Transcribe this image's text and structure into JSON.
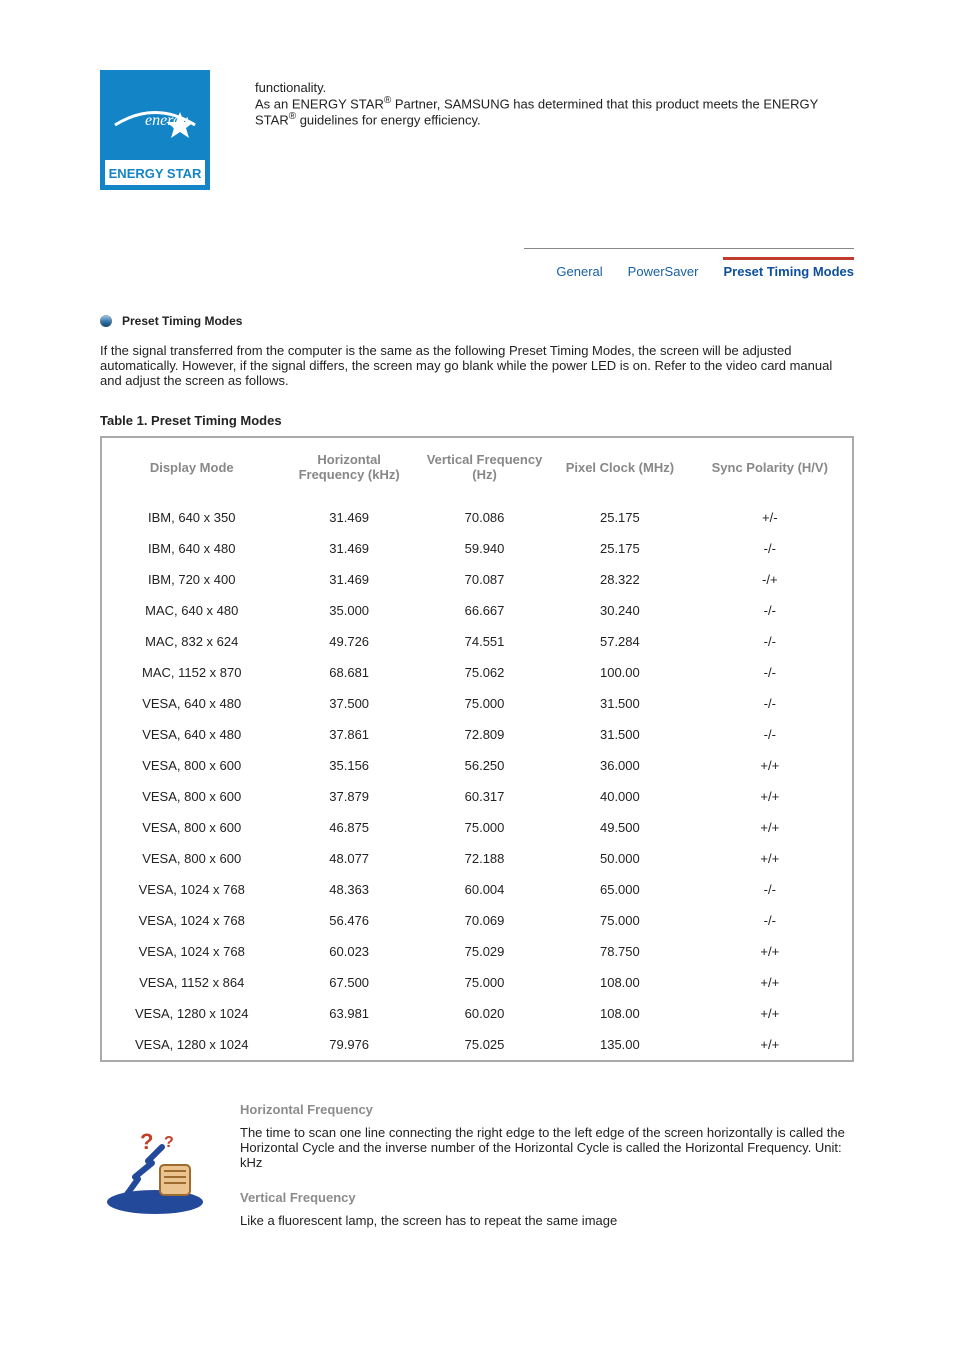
{
  "intro": {
    "line1": "functionality.",
    "line2a": "As an ENERGY STAR",
    "sup1": "®",
    "line2b": " Partner, SAMSUNG has determined that this product meets the ENERGY STAR",
    "sup2": "®",
    "line2c": " guidelines for energy efficiency."
  },
  "tabs": {
    "general": "General",
    "powersaver": "PowerSaver",
    "preset": "Preset Timing Modes"
  },
  "section": {
    "title": "Preset Timing Modes",
    "body": "If the signal transferred from the computer is the same as the following Preset Timing Modes, the screen will be adjusted automatically. However, if the signal differs, the screen may go blank while the power LED is on. Refer to the video card manual and adjust the screen as follows."
  },
  "table": {
    "caption": "Table 1. Preset Timing Modes",
    "headers": [
      "Display Mode",
      "Horizontal Frequency (kHz)",
      "Vertical Frequency (Hz)",
      "Pixel Clock (MHz)",
      "Sync Polarity (H/V)"
    ]
  },
  "chart_data": {
    "type": "table",
    "columns": [
      "Display Mode",
      "Horizontal Frequency (kHz)",
      "Vertical Frequency (Hz)",
      "Pixel Clock (MHz)",
      "Sync Polarity (H/V)"
    ],
    "rows": [
      [
        "IBM, 640 x 350",
        "31.469",
        "70.086",
        "25.175",
        "+/-"
      ],
      [
        "IBM, 640 x 480",
        "31.469",
        "59.940",
        "25.175",
        "-/-"
      ],
      [
        "IBM, 720 x 400",
        "31.469",
        "70.087",
        "28.322",
        "-/+"
      ],
      [
        "MAC, 640 x 480",
        "35.000",
        "66.667",
        "30.240",
        "-/-"
      ],
      [
        "MAC, 832 x 624",
        "49.726",
        "74.551",
        "57.284",
        "-/-"
      ],
      [
        "MAC, 1152 x 870",
        "68.681",
        "75.062",
        "100.00",
        "-/-"
      ],
      [
        "VESA, 640 x 480",
        "37.500",
        "75.000",
        "31.500",
        "-/-"
      ],
      [
        "VESA, 640 x 480",
        "37.861",
        "72.809",
        "31.500",
        "-/-"
      ],
      [
        "VESA, 800 x 600",
        "35.156",
        "56.250",
        "36.000",
        "+/+"
      ],
      [
        "VESA, 800 x 600",
        "37.879",
        "60.317",
        "40.000",
        "+/+"
      ],
      [
        "VESA, 800 x 600",
        "46.875",
        "75.000",
        "49.500",
        "+/+"
      ],
      [
        "VESA, 800 x 600",
        "48.077",
        "72.188",
        "50.000",
        "+/+"
      ],
      [
        "VESA, 1024 x 768",
        "48.363",
        "60.004",
        "65.000",
        "-/-"
      ],
      [
        "VESA, 1024 x 768",
        "56.476",
        "70.069",
        "75.000",
        "-/-"
      ],
      [
        "VESA, 1024 x 768",
        "60.023",
        "75.029",
        "78.750",
        "+/+"
      ],
      [
        "VESA, 1152 x 864",
        "67.500",
        "75.000",
        "108.00",
        "+/+"
      ],
      [
        "VESA, 1280 x 1024",
        "63.981",
        "60.020",
        "108.00",
        "+/+"
      ],
      [
        "VESA, 1280 x 1024",
        "79.976",
        "75.025",
        "135.00",
        "+/+"
      ]
    ]
  },
  "footer": {
    "h1": "Horizontal Frequency",
    "p1": "The time to scan one line connecting the right edge to the left edge of the screen horizontally is called the Horizontal Cycle and the inverse number of the Horizontal Cycle is called the Horizontal Frequency. Unit: kHz",
    "h2": "Vertical Frequency",
    "p2": "Like a fluorescent lamp, the screen has to repeat the same image"
  }
}
